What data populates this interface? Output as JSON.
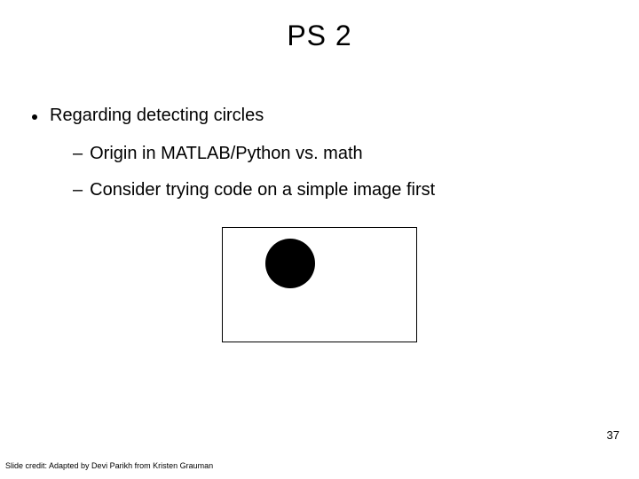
{
  "title": "PS 2",
  "bullets": {
    "l1_0": "Regarding detecting circles",
    "l2_0": "Origin in MATLAB/Python vs. math",
    "l2_1": "Consider trying code on a simple image first"
  },
  "page_number": "37",
  "credit": "Slide credit: Adapted by Devi Parikh from Kristen Grauman"
}
